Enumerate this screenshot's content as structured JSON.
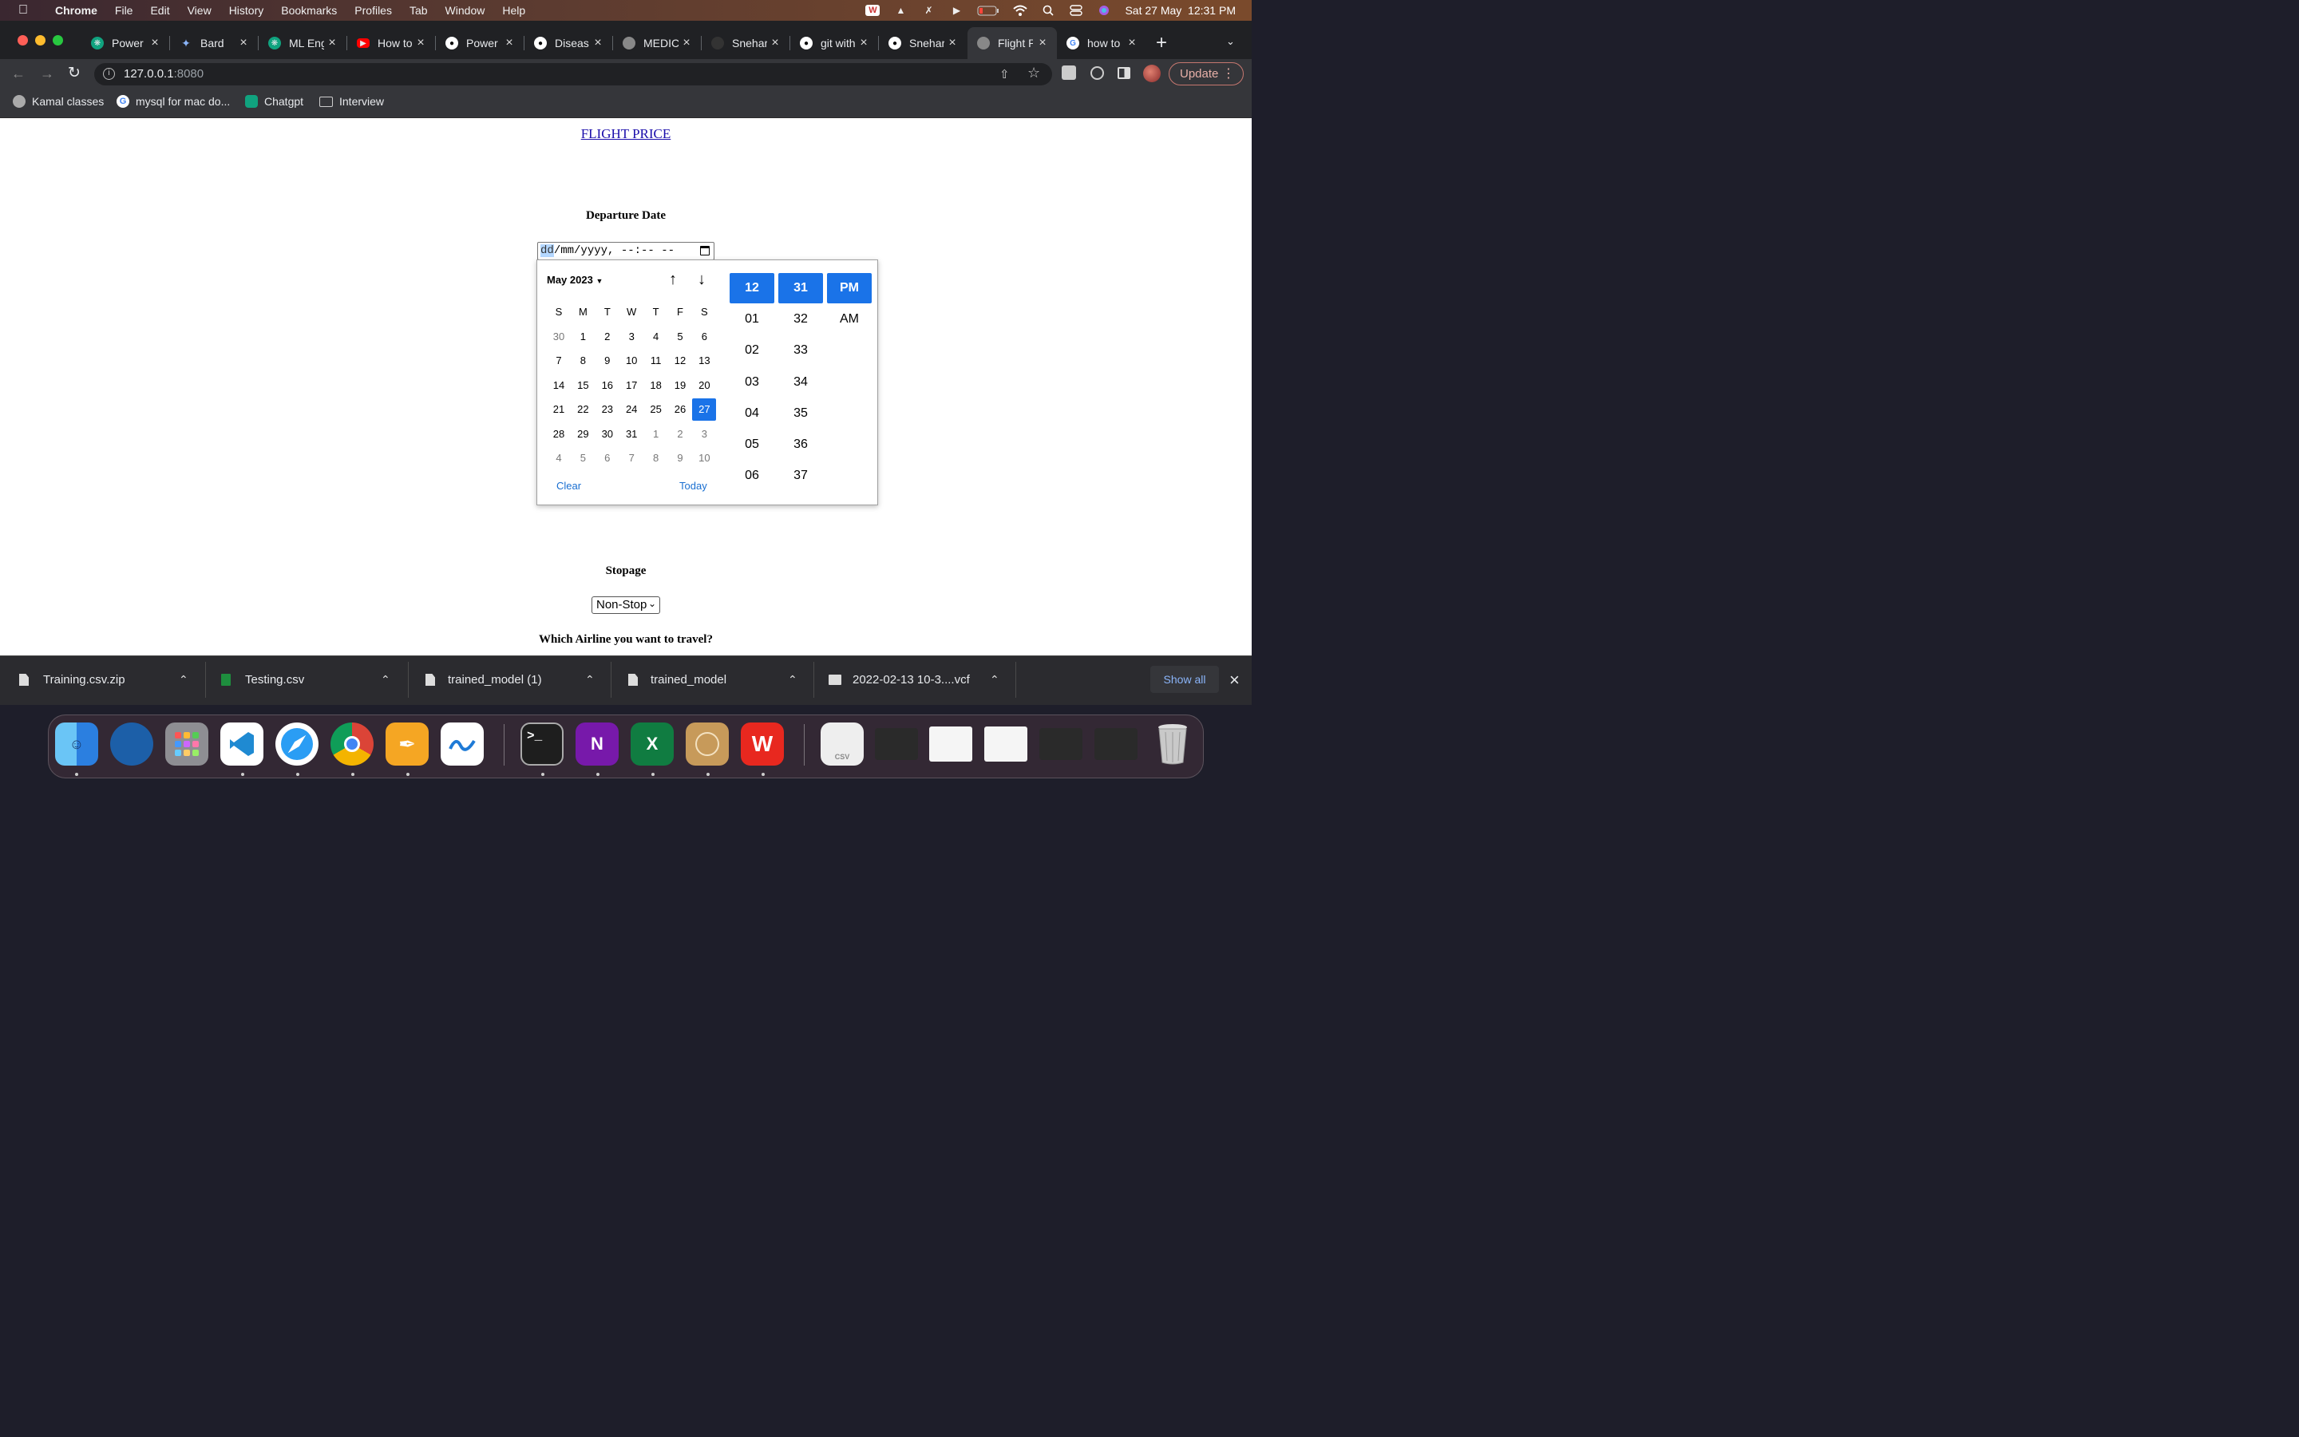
{
  "menubar": {
    "app": "Chrome",
    "items": [
      "File",
      "Edit",
      "View",
      "History",
      "Bookmarks",
      "Profiles",
      "Tab",
      "Window",
      "Help"
    ],
    "datetime": "Sat 27 May  12:31 PM"
  },
  "tabs": [
    {
      "title": "Power",
      "icon": "chatgpt-icon"
    },
    {
      "title": "Bard",
      "icon": "bard-icon"
    },
    {
      "title": "ML Eng",
      "icon": "chatgpt-icon"
    },
    {
      "title": "How to",
      "icon": "youtube-icon"
    },
    {
      "title": "Power",
      "icon": "github-icon"
    },
    {
      "title": "Diseas",
      "icon": "github-icon"
    },
    {
      "title": "MEDIC",
      "icon": "globe-icon"
    },
    {
      "title": "Snehar",
      "icon": "github-icon"
    },
    {
      "title": "git with",
      "icon": "github-icon"
    },
    {
      "title": "Snehar",
      "icon": "github-icon"
    },
    {
      "title": "Flight P",
      "icon": "globe-icon"
    },
    {
      "title": "how to",
      "icon": "google-icon"
    }
  ],
  "address": {
    "host": "127.0.0.1",
    "port": ":8080"
  },
  "update_label": "Update",
  "bookmarks": [
    {
      "label": "Kamal classes",
      "icon": "globe-icon"
    },
    {
      "label": "mysql for mac do...",
      "icon": "google-icon"
    },
    {
      "label": "Chatgpt",
      "icon": "chatgpt-icon"
    },
    {
      "label": "Interview",
      "icon": "folder-icon"
    }
  ],
  "page": {
    "title_link": "FLIGHT PRICE",
    "departure_label": "Departure Date",
    "date_input": {
      "dd": "dd",
      "rest": "/mm/yyyy, --:-- --"
    },
    "stopage_label": "Stopage",
    "stopage_value": "Non-Stop",
    "airline_label": "Which Airline you want to travel?"
  },
  "picker": {
    "month_label": "May 2023",
    "weekdays": [
      "S",
      "M",
      "T",
      "W",
      "T",
      "F",
      "S"
    ],
    "weeks": [
      [
        "30",
        "1",
        "2",
        "3",
        "4",
        "5",
        "6"
      ],
      [
        "7",
        "8",
        "9",
        "10",
        "11",
        "12",
        "13"
      ],
      [
        "14",
        "15",
        "16",
        "17",
        "18",
        "19",
        "20"
      ],
      [
        "21",
        "22",
        "23",
        "24",
        "25",
        "26",
        "27"
      ],
      [
        "28",
        "29",
        "30",
        "31",
        "1",
        "2",
        "3"
      ],
      [
        "4",
        "5",
        "6",
        "7",
        "8",
        "9",
        "10"
      ]
    ],
    "selected_day": "27",
    "clear_label": "Clear",
    "today_label": "Today",
    "hours": [
      "12",
      "01",
      "02",
      "03",
      "04",
      "05",
      "06"
    ],
    "minutes": [
      "31",
      "32",
      "33",
      "34",
      "35",
      "36",
      "37"
    ],
    "ampm": [
      "PM",
      "AM"
    ]
  },
  "downloads": {
    "items": [
      {
        "name": "Training.csv.zip",
        "icon": "file-icon"
      },
      {
        "name": "Testing.csv",
        "icon": "sheet-icon"
      },
      {
        "name": "trained_model (1)",
        "icon": "file-icon"
      },
      {
        "name": "trained_model",
        "icon": "file-icon"
      },
      {
        "name": "2022-02-13 10-3....vcf",
        "icon": "contact-card-icon"
      }
    ],
    "show_all": "Show all"
  },
  "dock": {
    "terminal_glyph": ">_",
    "onenote_glyph": "N",
    "excel_glyph": "X",
    "csv_label": "CSV"
  },
  "colors": {
    "accent": "#1a73e8",
    "link": "#1a0dab"
  }
}
